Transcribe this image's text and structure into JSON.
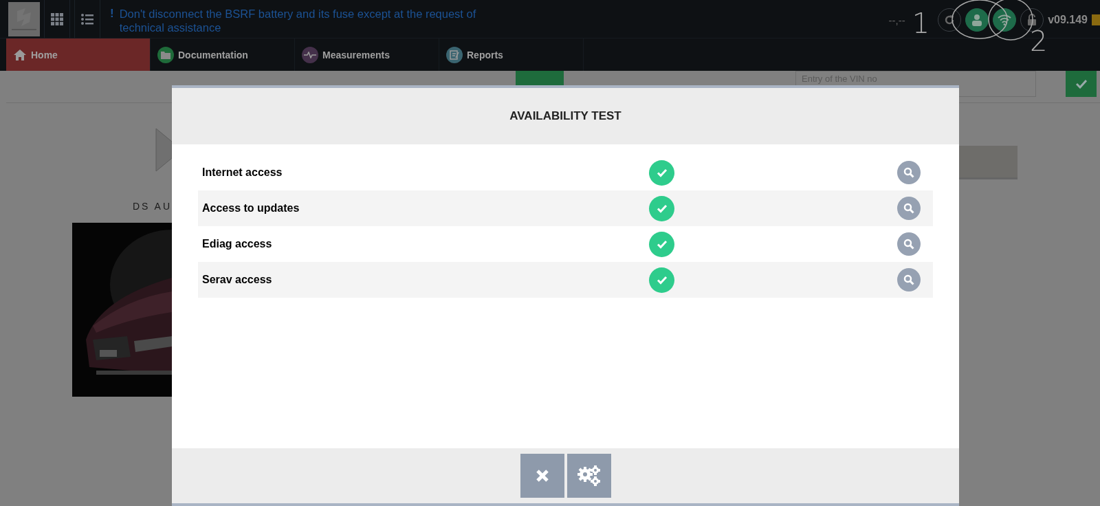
{
  "alert": {
    "mark": "!",
    "text": "Don't disconnect the BSRF battery and its fuse except at the request of technical assistance"
  },
  "status": {
    "time": "--,--",
    "version": "v09.149",
    "icons": [
      {
        "kind": "refresh",
        "on": false
      },
      {
        "kind": "user",
        "on": true
      },
      {
        "kind": "wifi",
        "on": true
      },
      {
        "kind": "lock",
        "on": false
      }
    ],
    "annotations": [
      "1",
      "2"
    ]
  },
  "tabs": [
    {
      "label": "Home",
      "selected": true
    },
    {
      "label": "Documentation",
      "selected": false
    },
    {
      "label": "Measurements",
      "selected": false
    },
    {
      "label": "Reports",
      "selected": false
    }
  ],
  "vin": {
    "placeholder": "Entry of the VIN no"
  },
  "brand": "DS AU",
  "dialog": {
    "title": "AVAILABILITY TEST",
    "rows": [
      {
        "label": "Internet access",
        "ok": true
      },
      {
        "label": "Access to updates",
        "ok": true
      },
      {
        "label": "Ediag access",
        "ok": true
      },
      {
        "label": "Serav access",
        "ok": true
      }
    ],
    "buttons": [
      {
        "kind": "close"
      },
      {
        "kind": "settings"
      }
    ]
  }
}
